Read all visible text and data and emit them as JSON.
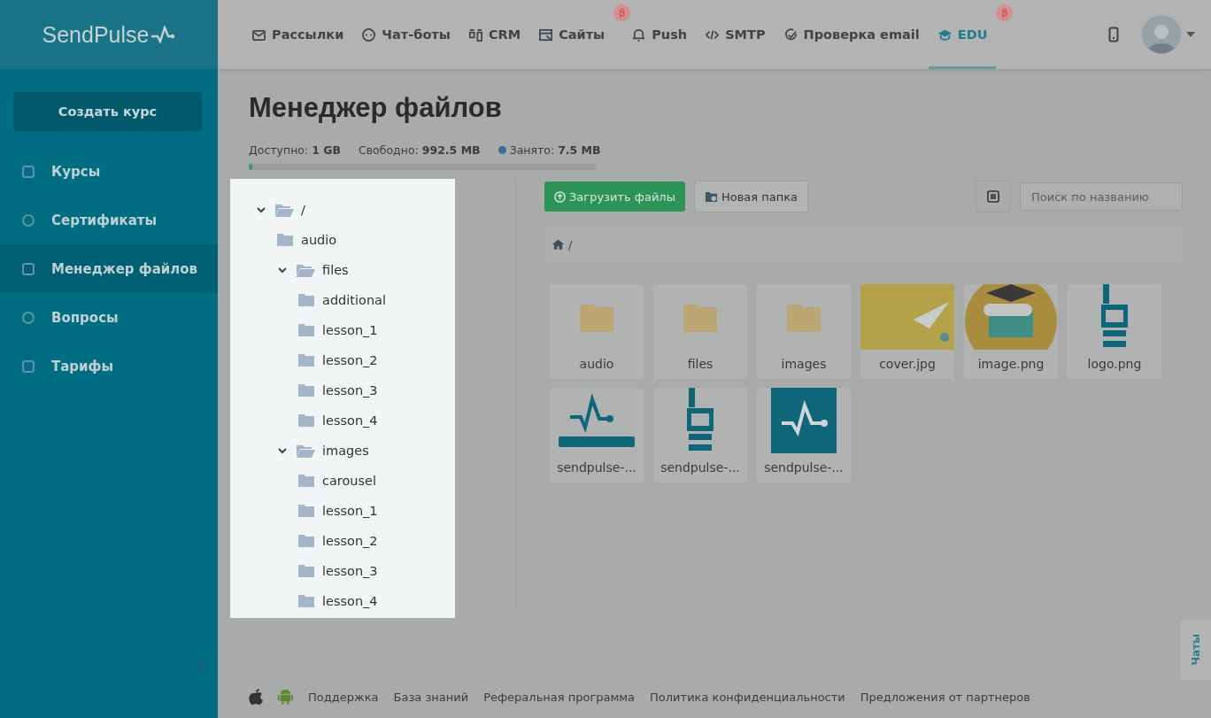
{
  "logo": "SendPulse",
  "nav": [
    {
      "label": "Рассылки",
      "selected": false
    },
    {
      "label": "Чат-боты",
      "selected": false
    },
    {
      "label": "CRM",
      "selected": false
    },
    {
      "label": "Сайты",
      "selected": false,
      "badge": "β"
    },
    {
      "label": "Push",
      "selected": false
    },
    {
      "label": "SMTP",
      "selected": false
    },
    {
      "label": "Проверка email",
      "selected": false
    },
    {
      "label": "EDU",
      "selected": true,
      "badge": "β"
    }
  ],
  "sidebar": {
    "create_button": "Создать курс",
    "items": [
      {
        "label": "Курсы",
        "selected": false
      },
      {
        "label": "Сертификаты",
        "selected": false
      },
      {
        "label": "Менеджер файлов",
        "selected": true
      },
      {
        "label": "Вопросы",
        "selected": false
      },
      {
        "label": "Тарифы",
        "selected": false
      }
    ]
  },
  "page_title": "Менеджер файлов",
  "storage": {
    "available_label": "Доступно:",
    "available": "1 GB",
    "free_label": "Свободно:",
    "free": "992.5 MB",
    "used_label": "Занято:",
    "used": "7.5 MB",
    "level": 0.01
  },
  "tree": {
    "label": "/",
    "expanded": true,
    "children": [
      {
        "label": "audio"
      },
      {
        "label": "files",
        "expanded": true,
        "children": [
          {
            "label": "additional"
          },
          {
            "label": "lesson_1"
          },
          {
            "label": "lesson_2"
          },
          {
            "label": "lesson_3"
          },
          {
            "label": "lesson_4"
          }
        ]
      },
      {
        "label": "images",
        "expanded": true,
        "children": [
          {
            "label": "carousel"
          },
          {
            "label": "lesson_1"
          },
          {
            "label": "lesson_2"
          },
          {
            "label": "lesson_3"
          },
          {
            "label": "lesson_4"
          }
        ]
      }
    ]
  },
  "toolbar": {
    "upload_button": "Загрузить файлы",
    "new_folder_button": "Новая папка",
    "search": {
      "placeholder": "Поиск по названию"
    }
  },
  "breadcrumb": "/",
  "files": [
    {
      "name": "audio",
      "kind": "folder"
    },
    {
      "name": "files",
      "kind": "folder"
    },
    {
      "name": "images",
      "kind": "folder"
    },
    {
      "name": "cover.jpg",
      "kind": "image"
    },
    {
      "name": "image.png",
      "kind": "image"
    },
    {
      "name": "logo.png",
      "kind": "image"
    },
    {
      "name": "sendpulse-...",
      "kind": "image"
    },
    {
      "name": "sendpulse-...",
      "kind": "image"
    },
    {
      "name": "sendpulse-...",
      "kind": "image"
    }
  ],
  "footer": {
    "links": [
      "Поддержка",
      "База знаний",
      "Реферальная программа",
      "Политика конфиденциальности",
      "Предложения от партнеров"
    ]
  },
  "chat_tab": "Чаты"
}
